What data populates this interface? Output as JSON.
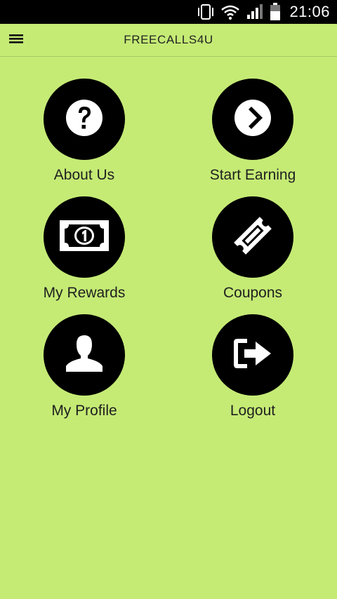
{
  "status_bar": {
    "time": "21:06",
    "icons": [
      "vibrate-icon",
      "wifi-icon",
      "signal-icon",
      "battery-icon"
    ]
  },
  "app_bar": {
    "title": "FREECALLS4U",
    "menu_icon": "hamburger-menu-icon"
  },
  "colors": {
    "background": "#c5eb75",
    "tile_circle": "#000000",
    "tile_icon": "#ffffff",
    "text": "#1f1f1f"
  },
  "menu": {
    "items": [
      {
        "label": "About Us",
        "icon": "question-icon"
      },
      {
        "label": "Start Earning",
        "icon": "chevron-right-icon"
      },
      {
        "label": "My Rewards",
        "icon": "banknote-icon"
      },
      {
        "label": "Coupons",
        "icon": "ticket-icon"
      },
      {
        "label": "My Profile",
        "icon": "user-icon"
      },
      {
        "label": "Logout",
        "icon": "logout-icon"
      }
    ]
  }
}
